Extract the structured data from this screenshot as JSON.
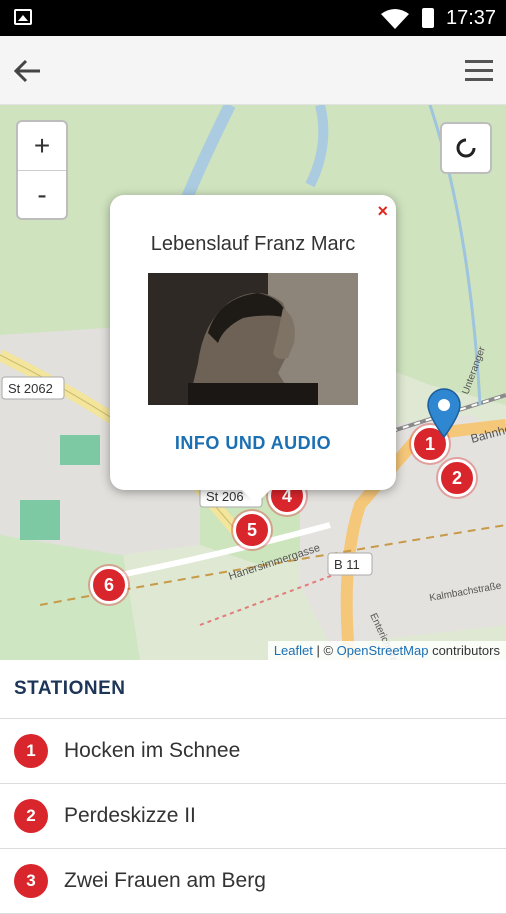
{
  "status_bar": {
    "time": "17:37"
  },
  "app_bar": {
    "back_icon": "arrow-left-icon",
    "menu_icon": "hamburger-menu-icon"
  },
  "map": {
    "zoom_in": "+",
    "zoom_out": "-",
    "reload_icon": "refresh-icon",
    "road_labels": [
      "St 2062",
      "St 206",
      "B 11",
      "Hanersimmergasse",
      "Unteranger",
      "Kalmbachstraße",
      "Enterichstraße",
      "Bahnho"
    ],
    "markers": [
      "1",
      "2",
      "4",
      "5",
      "6"
    ],
    "attribution": {
      "leaflet": "Leaflet",
      "separator": " | © ",
      "osm": "OpenStreetMap",
      "suffix": " contributors"
    }
  },
  "popup": {
    "close": "×",
    "title": "Lebenslauf Franz Marc",
    "info_link": "INFO UND AUDIO"
  },
  "stations": {
    "heading": "STATIONEN",
    "items": [
      {
        "number": "1",
        "label": "Hocken im Schnee"
      },
      {
        "number": "2",
        "label": "Perdeskizze II"
      },
      {
        "number": "3",
        "label": "Zwei Frauen am Berg"
      }
    ]
  },
  "colors": {
    "marker": "#d9262c",
    "link": "#1b6fb3",
    "heading": "#1d3557"
  }
}
